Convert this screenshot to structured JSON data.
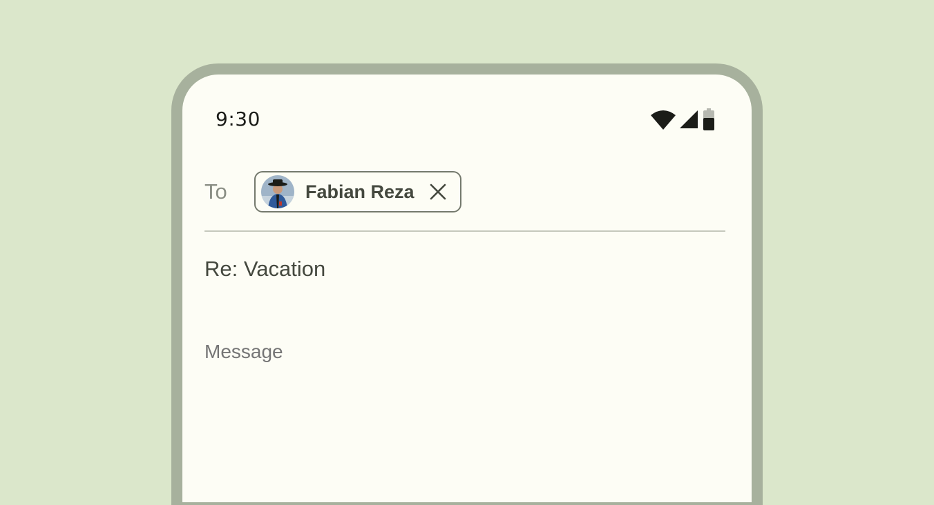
{
  "status_bar": {
    "time": "9:30",
    "icons": [
      "wifi-icon",
      "cellular-signal-icon",
      "battery-icon"
    ]
  },
  "compose": {
    "to_label": "To",
    "recipient": {
      "name": "Fabian Reza",
      "avatar": "avatar-photo",
      "remove_icon": "close-icon"
    },
    "subject": "Re: Vacation",
    "message_placeholder": "Message"
  },
  "colors": {
    "background": "#dbe7cb",
    "frame": "#a7b19d",
    "screen": "#fdfdf5",
    "chip_border": "#74796d",
    "text_primary": "#44483e",
    "text_hint": "#8a8e84",
    "divider": "#c5c8bc"
  }
}
